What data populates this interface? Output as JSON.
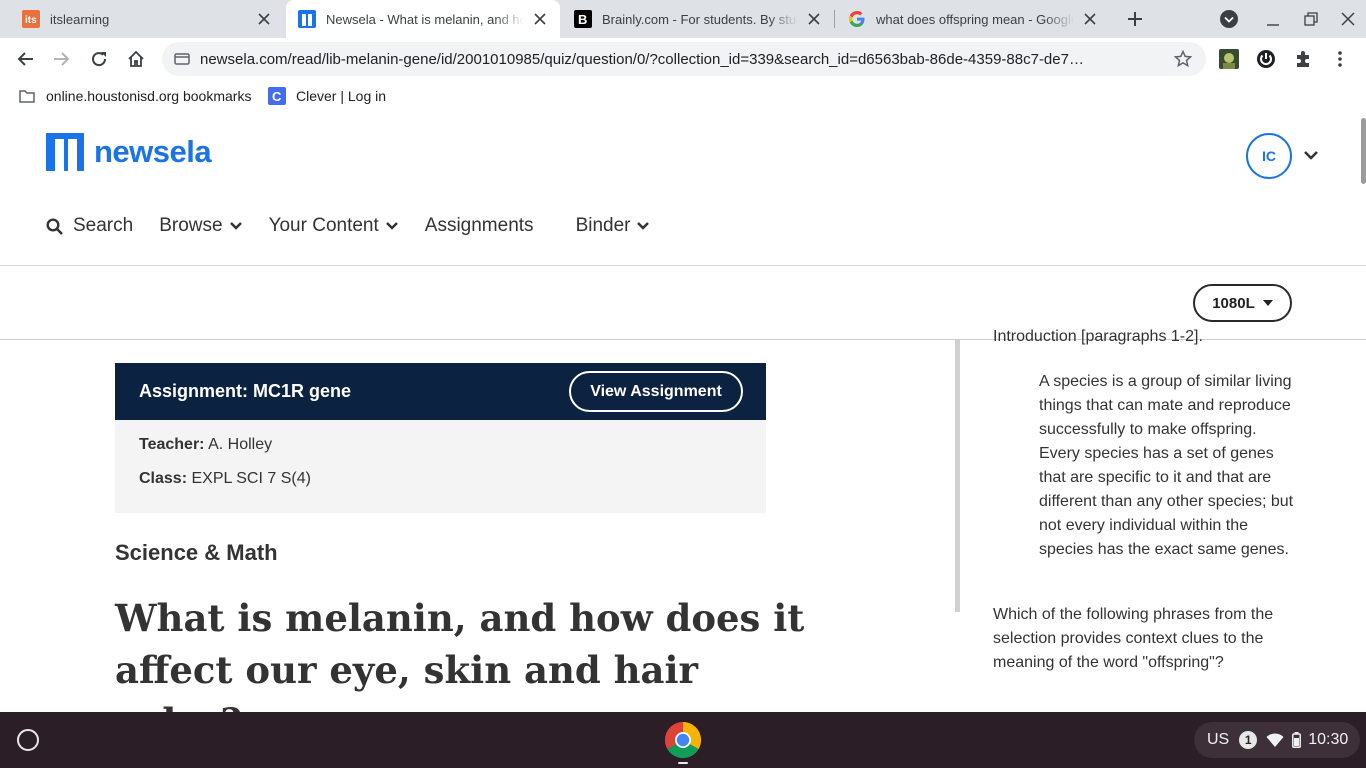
{
  "browser": {
    "tabs": [
      {
        "title": "itslearning",
        "favicon": "itslearning-favicon",
        "active": false
      },
      {
        "title": "Newsela - What is melanin, and how does it affect our eye, skin and hair color?",
        "favicon": "newsela-favicon",
        "active": true
      },
      {
        "title": "Brainly.com - For students. By students.",
        "favicon": "brainly-favicon",
        "active": false
      },
      {
        "title": "what does offspring mean - Google Search",
        "favicon": "google-favicon",
        "active": false
      }
    ],
    "url": "newsela.com/read/lib-melanin-gene/id/2001010985/quiz/question/0/?collection_id=339&search_id=d6563bab-86de-4359-88c7-de7…",
    "bookmarks": [
      {
        "label": "online.houstonisd.org bookmarks",
        "icon": "folder-icon"
      },
      {
        "label": "Clever | Log in",
        "icon": "clever-icon"
      }
    ]
  },
  "header": {
    "logo_text": "newsela",
    "avatar_initials": "IC",
    "nav": {
      "search": "Search",
      "browse": "Browse",
      "your_content": "Your Content",
      "assignments": "Assignments",
      "binder": "Binder"
    },
    "reading_level": "1080L"
  },
  "assignment": {
    "title": "Assignment: MC1R gene",
    "view_button": "View Assignment",
    "teacher_label": "Teacher:",
    "teacher": "A. Holley",
    "class_label": "Class:",
    "class": "EXPL SCI 7 S(4)"
  },
  "article": {
    "subject": "Science & Math",
    "headline": "What is melanin, and how does it affect our eye, skin and hair color?"
  },
  "quiz": {
    "intro_partial": "Introduction [paragraphs 1-2].",
    "quote": "A species is a group of similar living things that can mate and reproduce successfully to make offspring. Every species has a set of genes that are specific to it and that are different than any other species; but not every individual within the species has the exact same genes.",
    "question": "Which of the following phrases from the selection provides context clues to the meaning of the word \"offspring\"?"
  },
  "shelf": {
    "keyboard": "US",
    "notifications": "1",
    "time": "10:30"
  },
  "colors": {
    "newsela_blue": "#1a73e8",
    "assignment_navy": "#0b2240",
    "shelf": "#2b1e26"
  }
}
